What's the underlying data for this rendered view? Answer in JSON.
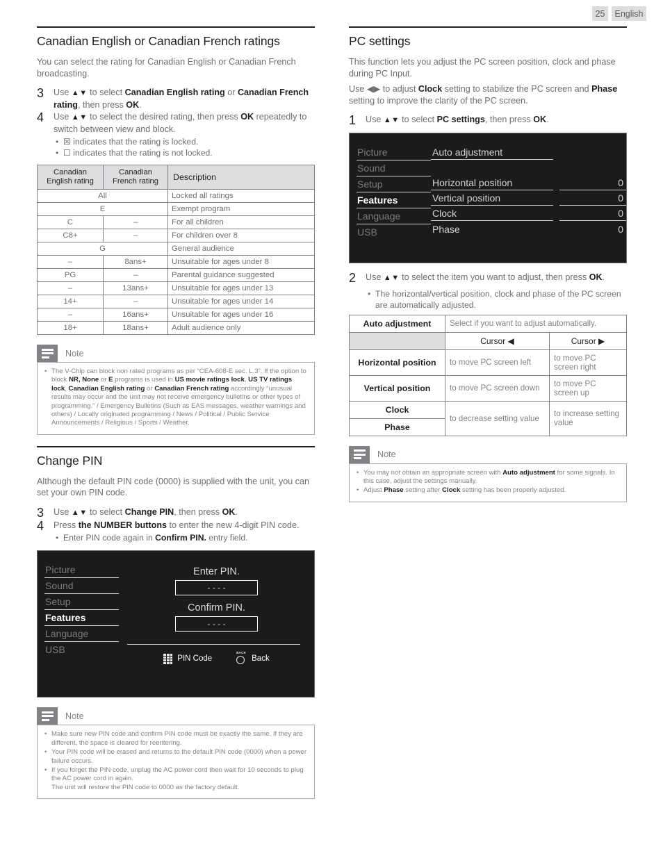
{
  "header": {
    "page_number": "25",
    "language": "English"
  },
  "left": {
    "section1": {
      "title": "Canadian English or Canadian French ratings",
      "intro": "You can select the rating for Canadian English or Canadian French broadcasting.",
      "steps": [
        {
          "num": "3",
          "text_parts": [
            "Use ",
            "▲▼",
            " to select ",
            "Canadian English rating",
            " or ",
            "Canadian French rating",
            ", then press ",
            "OK",
            "."
          ]
        },
        {
          "num": "4",
          "text_parts": [
            "Use ",
            "▲▼",
            " to select the desired rating, then press ",
            "OK",
            " repeatedly to switch between view and block."
          ]
        }
      ],
      "bullets": [
        {
          "glyph": "☒",
          "text": "indicates that the rating is locked."
        },
        {
          "glyph": "☐",
          "text": "indicates that the rating is not locked."
        }
      ],
      "table": {
        "headers": [
          "Canadian\nEnglish rating",
          "Canadian\nFrench rating",
          "Description"
        ],
        "header_en": "Canadian English rating",
        "header_fr": "Canadian French rating",
        "header_desc": "Description",
        "rows": [
          {
            "span": true,
            "en": "All",
            "fr": "",
            "desc": "Locked all ratings"
          },
          {
            "span": true,
            "en": "E",
            "fr": "",
            "desc": "Exempt program"
          },
          {
            "span": false,
            "en": "C",
            "fr": "–",
            "desc": "For all children"
          },
          {
            "span": false,
            "en": "C8+",
            "fr": "–",
            "desc": "For children over 8"
          },
          {
            "span": true,
            "en": "G",
            "fr": "",
            "desc": "General audience"
          },
          {
            "span": false,
            "en": "–",
            "fr": "8ans+",
            "desc": "Unsuitable for ages under 8"
          },
          {
            "span": false,
            "en": "PG",
            "fr": "–",
            "desc": "Parental guidance suggested"
          },
          {
            "span": false,
            "en": "–",
            "fr": "13ans+",
            "desc": "Unsuitable for ages under 13"
          },
          {
            "span": false,
            "en": "14+",
            "fr": "–",
            "desc": "Unsuitable for ages under 14"
          },
          {
            "span": false,
            "en": "–",
            "fr": "16ans+",
            "desc": "Unsuitable for ages under 16"
          },
          {
            "span": false,
            "en": "18+",
            "fr": "18ans+",
            "desc": "Adult audience only"
          }
        ]
      },
      "note": {
        "title": "Note",
        "items": [
          "The V-Chip can block non rated programs as per “CEA-608-E sec. L.3”. If the option to block NR, None or E programs is used in US movie ratings lock, US TV ratings lock, Canadian English rating or Canadian French rating accordingly “unusual results may occur and the unit may not receive emergency bulletins or other types of programming.” / Emergency Bulletins (Such as EAS messages, weather warnings and others) / Locally originated programming / News / Political / Public Service Announcements / Religious / Sports / Weather."
        ]
      }
    },
    "section2": {
      "title": "Change PIN",
      "intro": "Although the default PIN code (0000) is supplied with the unit, you can set your own PIN code.",
      "steps": [
        {
          "num": "3",
          "text_parts": [
            "Use ",
            "▲▼",
            " to select ",
            "Change PIN",
            ", then press ",
            "OK",
            "."
          ]
        },
        {
          "num": "4",
          "text_parts": [
            "Press ",
            "the NUMBER buttons",
            " to enter the new 4-digit PIN code."
          ]
        }
      ],
      "substep": {
        "text": "Enter PIN code again in ",
        "bold": "Confirm PIN.",
        "tail": " entry field."
      },
      "osd": {
        "menu": [
          {
            "label": "Picture",
            "selected": false
          },
          {
            "label": "Sound",
            "selected": false
          },
          {
            "label": "Setup",
            "selected": false
          },
          {
            "label": "Features",
            "selected": true
          },
          {
            "label": "Language",
            "selected": false
          },
          {
            "label": "USB",
            "selected": false
          }
        ],
        "enter_pin_label": "Enter PIN.",
        "enter_pin_value": "-   -   -   -",
        "confirm_pin_label": "Confirm PIN.",
        "confirm_pin_value": "-   -   -   -",
        "footer": [
          {
            "icon": "keypad-icon",
            "label": "PIN Code"
          },
          {
            "icon": "back-icon",
            "label": "Back",
            "icon_text": "BACK"
          }
        ]
      },
      "note": {
        "title": "Note",
        "items": [
          "Make sure new PIN code and confirm PIN code must be exactly the same. If they are different, the space is cleared for reentering.",
          "Your PIN code will be erased and returns to the default PIN code (0000) when a power failure occurs.",
          "If you forget the PIN code, unplug the AC power cord then wait for 10 seconds to plug the AC power cord in again.\nThe unit will restore the PIN code to 0000 as the factory default."
        ]
      }
    }
  },
  "right": {
    "title": "PC settings",
    "intro1": "This function lets you adjust the PC screen position, clock and phase during PC Input.",
    "intro2_parts": [
      "Use ",
      "◀▶",
      " to adjust ",
      "Clock",
      " setting to stabilize the PC screen and ",
      "Phase",
      " setting to improve the clarity of the PC screen."
    ],
    "step1": {
      "num": "1",
      "text_parts": [
        "Use ",
        "▲▼",
        " to select ",
        "PC settings",
        ", then  press ",
        "OK",
        "."
      ]
    },
    "osd": {
      "menu": [
        {
          "label": "Picture",
          "selected": false
        },
        {
          "label": "Sound",
          "selected": false
        },
        {
          "label": "Setup",
          "selected": false
        },
        {
          "label": "Features",
          "selected": true
        },
        {
          "label": "Language",
          "selected": false
        },
        {
          "label": "USB",
          "selected": false
        }
      ],
      "rows": [
        {
          "name": "Auto adjustment",
          "value": "",
          "has_value": false
        },
        {
          "name": "",
          "value": "",
          "has_value": false,
          "blank": true
        },
        {
          "name": "Horizontal position",
          "value": "0",
          "has_value": true
        },
        {
          "name": "Vertical position",
          "value": "0",
          "has_value": true
        },
        {
          "name": "Clock",
          "value": "0",
          "has_value": true
        },
        {
          "name": "Phase",
          "value": "0",
          "has_value": true,
          "no_line": true
        }
      ]
    },
    "step2": {
      "num": "2",
      "text_parts": [
        "Use ",
        "▲▼",
        " to select the item you want to adjust, then press ",
        "OK",
        "."
      ]
    },
    "step2_bullet": "The horizontal/vertical position, clock and phase of the PC screen are automatically adjusted.",
    "cursor_table": {
      "auto_label": "Auto adjustment",
      "auto_desc": "Select if you want to adjust automatically.",
      "col_left": "Cursor ◀",
      "col_right": "Cursor ▶",
      "rows": [
        {
          "label": "Horizontal position",
          "left": "to move PC screen left",
          "right": "to move PC screen right"
        },
        {
          "label": "Vertical position",
          "left": "to move PC screen down",
          "right": "to move PC screen up"
        }
      ],
      "merged_labels": [
        "Clock",
        "Phase"
      ],
      "merged_left": "to decrease setting value",
      "merged_right": "to increase setting value"
    },
    "note": {
      "title": "Note",
      "items": [
        "You may not obtain an appropriate screen with Auto adjustment for some signals. In this case, adjust the settings manually.",
        "Adjust Phase setting after Clock setting has been properly adjusted."
      ]
    }
  }
}
